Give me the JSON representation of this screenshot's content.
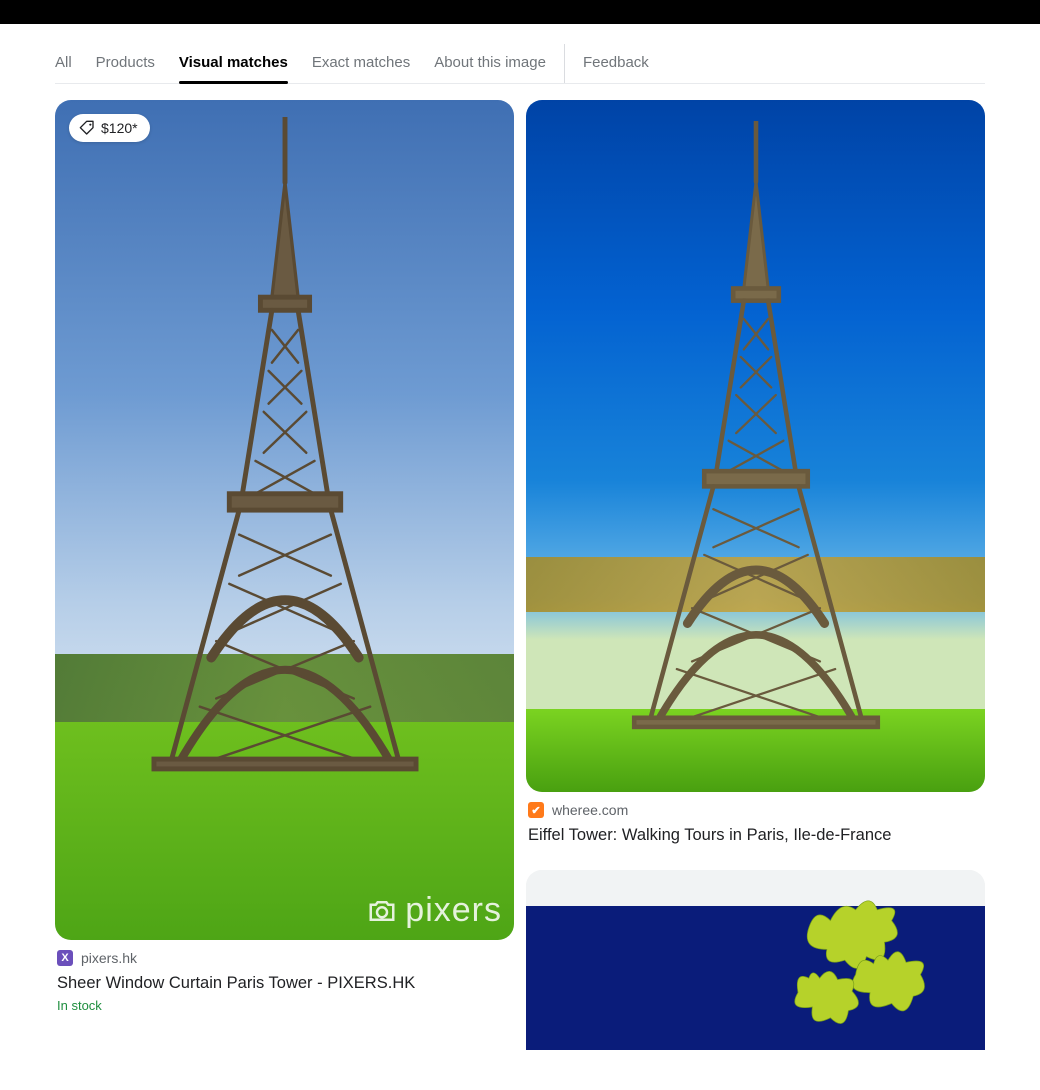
{
  "tabs": [
    {
      "label": "All",
      "active": false
    },
    {
      "label": "Products",
      "active": false
    },
    {
      "label": "Visual matches",
      "active": true
    },
    {
      "label": "Exact matches",
      "active": false
    },
    {
      "label": "About this image",
      "active": false
    },
    {
      "label": "Feedback",
      "active": false,
      "separated": true
    }
  ],
  "results": {
    "card1": {
      "price_badge": "$120*",
      "source": "pixers.hk",
      "title": "Sheer Window Curtain Paris Tower - PIXERS.HK",
      "stock": "In stock",
      "watermark": "pixers",
      "favicon_bg": "#6b4fbb",
      "favicon_letter": "X"
    },
    "card2": {
      "source": "wheree.com",
      "title": "Eiffel Tower: Walking Tours in Paris, Ile-de-France",
      "favicon_bg": "#ff7a1a",
      "favicon_letter": "✔"
    }
  }
}
